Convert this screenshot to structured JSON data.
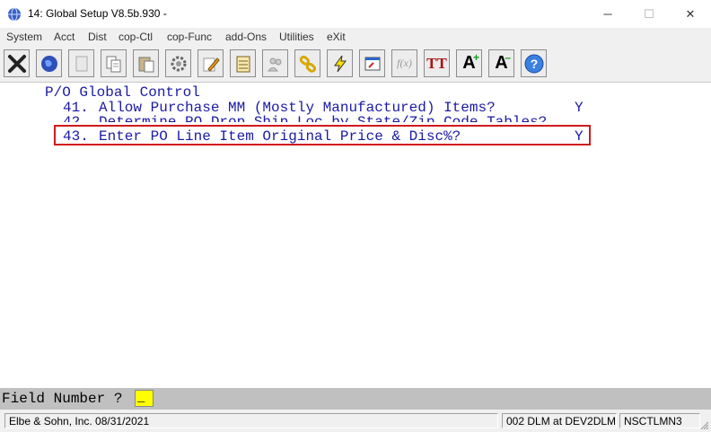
{
  "window": {
    "title": "14: Global Setup V8.5b.930 -",
    "minimize": "─",
    "maximize": "☐",
    "close": "✕"
  },
  "menu": [
    "System",
    "Acct",
    "Dist",
    "cop-Ctl",
    "cop-Func",
    "add-Ons",
    "Utilities",
    "eXit"
  ],
  "toolbar": {
    "icons": [
      "close-x-icon",
      "globe-icon",
      "blank-page-icon",
      "copy-icon",
      "paste-icon",
      "settings-gear-icon",
      "edit-pencil-icon",
      "notepad-icon",
      "users-icon",
      "link-chain-icon",
      "lightning-icon",
      "window-icon",
      "function-icon",
      "font-style-icon",
      "font-increase-icon",
      "font-decrease-icon",
      "help-icon"
    ],
    "fx_label": "f(x)",
    "font_label": "TT",
    "font_up_label": "A",
    "font_down_label": "A"
  },
  "screen": {
    "heading": "P/O Global Control",
    "items": [
      {
        "num": "41.",
        "text": "Allow Purchase MM (Mostly Manufactured) Items?",
        "value": "Y"
      },
      {
        "num": "42.",
        "text": "Determine PO Drop Ship Loc by State/Zip Code Tables?",
        "value": ""
      },
      {
        "num": "43.",
        "text": "Enter PO Line Item Original Price & Disc%?",
        "value": "Y"
      }
    ]
  },
  "prompt": {
    "label": "Field Number ?",
    "value": "_"
  },
  "status": {
    "company": "Elbe & Sohn, Inc. 08/31/2021",
    "session": "002 DLM at DEV2DLM",
    "code": "NSCTLMN3"
  },
  "colors": {
    "screen_text": "#1a1aa6",
    "highlight_border": "#d11a1a",
    "input_bg": "#ffff00"
  }
}
